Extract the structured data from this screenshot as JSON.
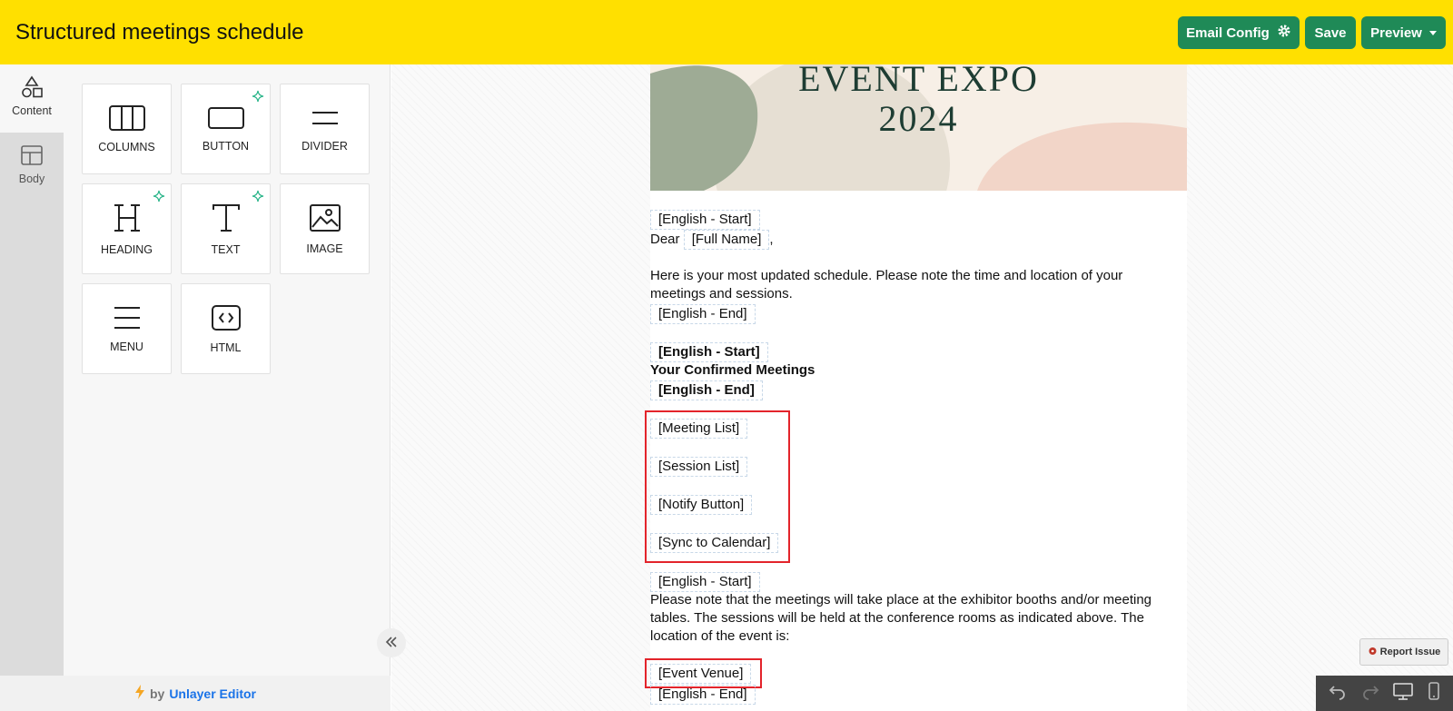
{
  "header": {
    "title": "Structured meetings schedule",
    "email_config_label": "Email Config",
    "save_label": "Save",
    "preview_label": "Preview",
    "bg_color": "#ffe000",
    "button_color": "#1f8a57"
  },
  "rail": {
    "tabs": [
      {
        "label": "Content",
        "icon": "shapes-icon",
        "active": true
      },
      {
        "label": "Body",
        "icon": "layout-icon",
        "active": false
      }
    ]
  },
  "tools": [
    {
      "label": "COLUMNS",
      "icon": "columns-icon",
      "ai": false
    },
    {
      "label": "BUTTON",
      "icon": "button-icon",
      "ai": true
    },
    {
      "label": "DIVIDER",
      "icon": "divider-icon",
      "ai": false
    },
    {
      "label": "HEADING",
      "icon": "heading-icon",
      "ai": true
    },
    {
      "label": "TEXT",
      "icon": "text-icon",
      "ai": true
    },
    {
      "label": "IMAGE",
      "icon": "image-icon",
      "ai": false
    },
    {
      "label": "MENU",
      "icon": "menu-icon",
      "ai": false
    },
    {
      "label": "HTML",
      "icon": "code-icon",
      "ai": false
    }
  ],
  "credit": {
    "by": "by",
    "link": "Unlayer Editor"
  },
  "email": {
    "banner_line1": "EVENT EXPO",
    "banner_line2": "2024",
    "en_start_1": "[English - Start]",
    "dear": "Dear",
    "full_name": "[Full Name]",
    "comma": ",",
    "intro": "Here is your most updated schedule. Please note the time and location of your meetings and sessions.",
    "en_end_1": "[English - End]",
    "en_start_2": "[English - Start]",
    "confirmed_heading": "Your Confirmed Meetings",
    "en_end_2": "[English - End]",
    "meeting_list": "[Meeting List]",
    "session_list": "[Session List]",
    "notify_button": "[Notify Button]",
    "sync_calendar": "[Sync to Calendar]",
    "en_start_3": "[English - Start]",
    "location_note": "Please note that the meetings will take place at the exhibitor booths and/or meeting tables. The sessions will be held at the conference rooms as indicated above. The location of the event is:",
    "event_venue": "[Event Venue]",
    "en_end_3": "[English - End]"
  },
  "report_issue": "Report Issue"
}
